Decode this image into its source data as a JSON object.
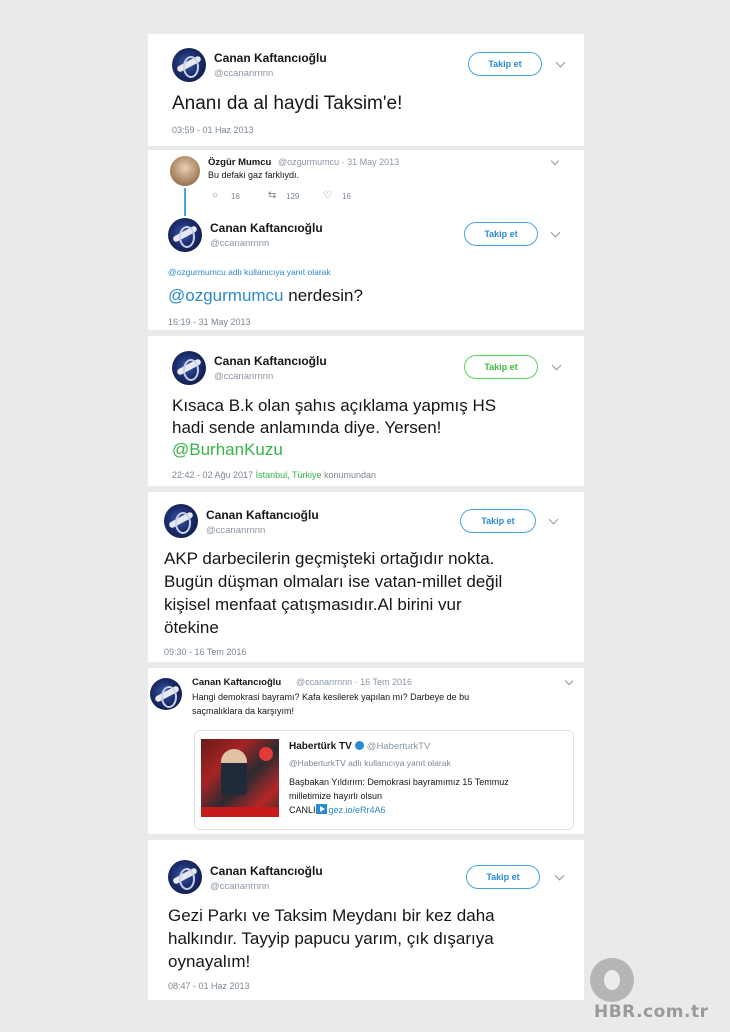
{
  "user": {
    "name": "Canan Kaftancıoğlu",
    "handle": "@ccananrnnn"
  },
  "follow_label": "Takip et",
  "tweets": [
    {
      "text": "Ananı da al haydi Taksim'e!",
      "time": "03:59 - 01 Haz 2013"
    },
    {
      "parent": {
        "name": "Özgür Mumcu",
        "handle_date": "@ozgurmumcu · 31 May 2013",
        "text": "Bu defaki gaz farklıydı.",
        "replies": "16",
        "retweets": "129",
        "likes": "16"
      },
      "reply_note": "@ozgurmumcu adlı kullanıcıya yanıt olarak",
      "mention": "@ozgurmumcu",
      "text": " nerdesin?",
      "time": "16:19 - 31 May 2013"
    },
    {
      "line1": "Kısaca B.k olan şahıs açıklama yapmış HS",
      "line2": "hadi sende anlamında diye. Yersen!",
      "mention": "@BurhanKuzu",
      "time": "22:42 - 02 Ağu 2017",
      "location": "İstanbul, Türkiye",
      "location_suffix": " konumundan"
    },
    {
      "line1": "AKP darbecilerin geçmişteki ortağıdır nokta.",
      "line2": "Bugün düşman olmaları ise vatan-millet değil",
      "line3": "kişisel menfaat çatışmasıdır.Al birini vur",
      "line4": "ötekine",
      "time": "09:30 - 16 Tem 2016"
    },
    {
      "header_handle_date": "@ccananrnnn · 16 Tem 2016",
      "line1": "Hangi demokrasi bayramı? Kafa kesilerek yapılan mı? Darbeye de bu",
      "line2": "saçmalıklara da karşıyım!",
      "quote": {
        "name": "Habertürk TV",
        "handle": "@HaberturkTV",
        "reply_note": "@HaberturkTV adlı kullanıcıya yanıt olarak",
        "line1": "Başbakan Yıldırım: Demokrasi bayramımız 15 Temmuz",
        "line2": "milletimize hayırlı olsun",
        "live": "CANLI",
        "url": "gez.io/eRr4A6"
      }
    },
    {
      "line1": "Gezi Parkı ve Taksim Meydanı bir kez daha",
      "line2": "halkındır. Tayyip papucu yarım, çık dışarıya",
      "line3": "oynayalım!",
      "time": "08:47 - 01 Haz 2013"
    }
  ],
  "watermark": {
    "domain": "HBR.com.tr"
  },
  "colors": {
    "link": "#2a8ad2",
    "follow_border": "#4aa3df",
    "highlight_green": "#5bd35b",
    "meta": "#7b8793"
  }
}
